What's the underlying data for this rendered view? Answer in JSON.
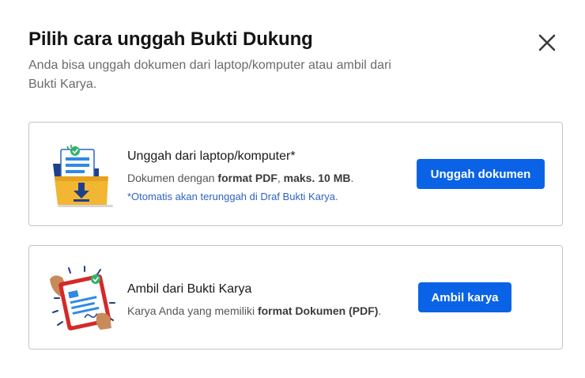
{
  "modal": {
    "title": "Pilih cara unggah Bukti Dukung",
    "subtitle": "Anda bisa unggah dokumen dari laptop/komputer atau ambil dari Bukti Karya."
  },
  "options": [
    {
      "title": "Unggah dari laptop/komputer*",
      "desc_prefix": "Dokumen dengan ",
      "desc_bold_1": "format PDF",
      "desc_sep": ", ",
      "desc_bold_2": "maks. 10 MB",
      "desc_suffix": ".",
      "note": "*Otomatis akan terunggah di Draf Bukti Karya.",
      "button_label": "Unggah dokumen",
      "icon": "folder-upload-icon"
    },
    {
      "title": "Ambil dari Bukti Karya",
      "desc_prefix": "Karya Anda yang memiliki ",
      "desc_bold_1": "format Dokumen (PDF)",
      "desc_suffix": ".",
      "button_label": "Ambil karya",
      "icon": "tablet-document-icon"
    }
  ],
  "colors": {
    "primary": "#0a63e6",
    "note": "#2f63c5",
    "border": "#c4c4c4"
  }
}
